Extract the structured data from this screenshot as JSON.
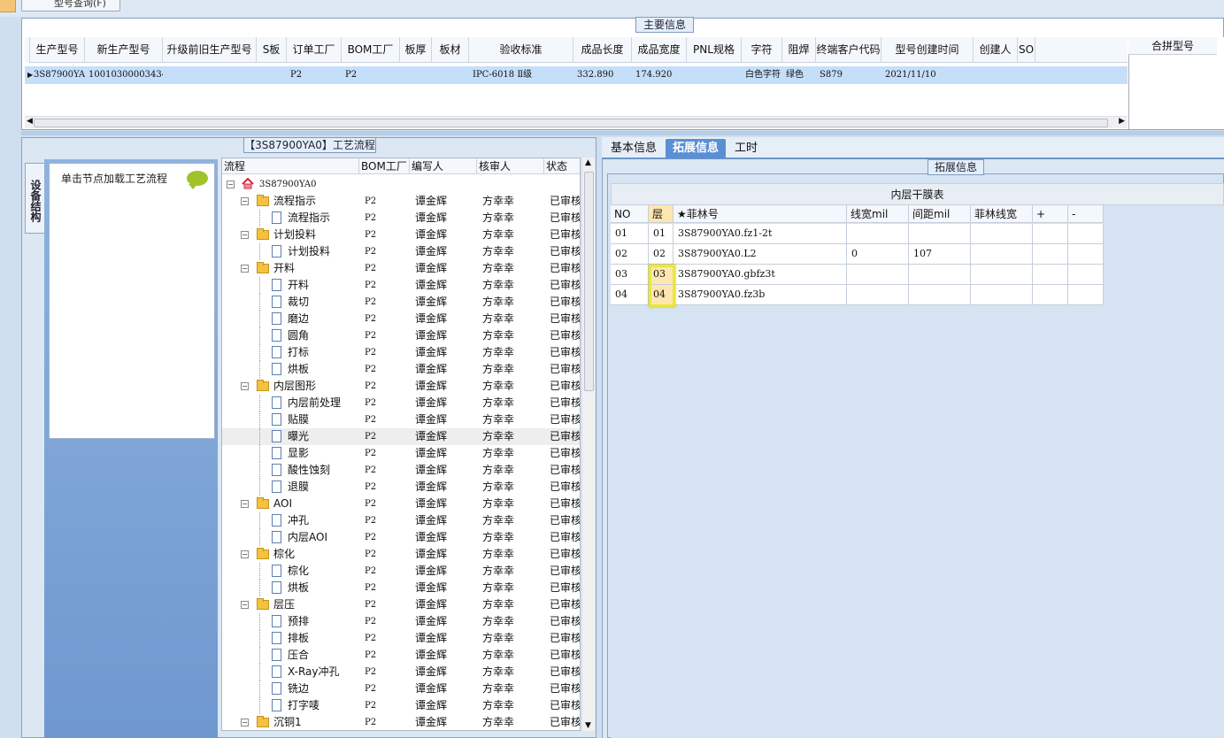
{
  "toolbar": {
    "query_button": "型号查询(F)"
  },
  "main_info": {
    "title": "主要信息",
    "columns": [
      "生产型号",
      "新生产型号",
      "升级前旧生产型号",
      "S板",
      "订单工厂",
      "BOM工厂",
      "板厚",
      "板材",
      "验收标准",
      "成品长度",
      "成品宽度",
      "PNL规格",
      "字符",
      "阻焊",
      "终端客户代码",
      "型号创建时间",
      "创建人",
      "SO"
    ],
    "row": [
      "3S87900YA0",
      "10010300003434",
      "",
      "",
      "P2",
      "P2",
      "",
      "",
      "IPC-6018 Ⅱ级",
      "332.890",
      "174.920",
      "",
      "白色字符",
      "绿色",
      "S879",
      "2021/11/10",
      "",
      ""
    ],
    "merge_header": "合拼型号"
  },
  "left": {
    "process_title": "【3S87900YA0】工艺流程",
    "side_tab": "设备结构",
    "node_hint": "单击节点加载工艺流程",
    "tree_headers": [
      "流程",
      "BOM工厂",
      "编写人",
      "核审人",
      "状态"
    ],
    "tree": [
      {
        "level": 0,
        "type": "root",
        "name": "3S87900YA0",
        "factory": "",
        "writer": "",
        "reviewer": "",
        "status": ""
      },
      {
        "level": 1,
        "type": "folder",
        "name": "流程指示",
        "factory": "P2",
        "writer": "谭金辉",
        "reviewer": "方幸幸",
        "status": "已审核"
      },
      {
        "level": 2,
        "type": "doc",
        "name": "流程指示",
        "factory": "P2",
        "writer": "谭金辉",
        "reviewer": "方幸幸",
        "status": "已审核"
      },
      {
        "level": 1,
        "type": "folder",
        "name": "计划投料",
        "factory": "P2",
        "writer": "谭金辉",
        "reviewer": "方幸幸",
        "status": "已审核"
      },
      {
        "level": 2,
        "type": "doc",
        "name": "计划投料",
        "factory": "P2",
        "writer": "谭金辉",
        "reviewer": "方幸幸",
        "status": "已审核"
      },
      {
        "level": 1,
        "type": "folder",
        "name": "开料",
        "factory": "P2",
        "writer": "谭金辉",
        "reviewer": "方幸幸",
        "status": "已审核"
      },
      {
        "level": 2,
        "type": "doc",
        "name": "开料",
        "factory": "P2",
        "writer": "谭金辉",
        "reviewer": "方幸幸",
        "status": "已审核"
      },
      {
        "level": 2,
        "type": "doc",
        "name": "裁切",
        "factory": "P2",
        "writer": "谭金辉",
        "reviewer": "方幸幸",
        "status": "已审核"
      },
      {
        "level": 2,
        "type": "doc",
        "name": "磨边",
        "factory": "P2",
        "writer": "谭金辉",
        "reviewer": "方幸幸",
        "status": "已审核"
      },
      {
        "level": 2,
        "type": "doc",
        "name": "圆角",
        "factory": "P2",
        "writer": "谭金辉",
        "reviewer": "方幸幸",
        "status": "已审核"
      },
      {
        "level": 2,
        "type": "doc",
        "name": "打标",
        "factory": "P2",
        "writer": "谭金辉",
        "reviewer": "方幸幸",
        "status": "已审核"
      },
      {
        "level": 2,
        "type": "doc",
        "name": "烘板",
        "factory": "P2",
        "writer": "谭金辉",
        "reviewer": "方幸幸",
        "status": "已审核"
      },
      {
        "level": 1,
        "type": "folder",
        "name": "内层图形",
        "factory": "P2",
        "writer": "谭金辉",
        "reviewer": "方幸幸",
        "status": "已审核"
      },
      {
        "level": 2,
        "type": "doc",
        "name": "内层前处理",
        "factory": "P2",
        "writer": "谭金辉",
        "reviewer": "方幸幸",
        "status": "已审核"
      },
      {
        "level": 2,
        "type": "doc",
        "name": "贴膜",
        "factory": "P2",
        "writer": "谭金辉",
        "reviewer": "方幸幸",
        "status": "已审核"
      },
      {
        "level": 2,
        "type": "doc",
        "name": "曝光",
        "factory": "P2",
        "writer": "谭金辉",
        "reviewer": "方幸幸",
        "status": "已审核",
        "selected": true
      },
      {
        "level": 2,
        "type": "doc",
        "name": "显影",
        "factory": "P2",
        "writer": "谭金辉",
        "reviewer": "方幸幸",
        "status": "已审核"
      },
      {
        "level": 2,
        "type": "doc",
        "name": "酸性蚀刻",
        "factory": "P2",
        "writer": "谭金辉",
        "reviewer": "方幸幸",
        "status": "已审核"
      },
      {
        "level": 2,
        "type": "doc",
        "name": "退膜",
        "factory": "P2",
        "writer": "谭金辉",
        "reviewer": "方幸幸",
        "status": "已审核"
      },
      {
        "level": 1,
        "type": "folder",
        "name": "AOI",
        "factory": "P2",
        "writer": "谭金辉",
        "reviewer": "方幸幸",
        "status": "已审核"
      },
      {
        "level": 2,
        "type": "doc",
        "name": "冲孔",
        "factory": "P2",
        "writer": "谭金辉",
        "reviewer": "方幸幸",
        "status": "已审核"
      },
      {
        "level": 2,
        "type": "doc",
        "name": "内层AOI",
        "factory": "P2",
        "writer": "谭金辉",
        "reviewer": "方幸幸",
        "status": "已审核"
      },
      {
        "level": 1,
        "type": "folder",
        "name": "棕化",
        "factory": "P2",
        "writer": "谭金辉",
        "reviewer": "方幸幸",
        "status": "已审核"
      },
      {
        "level": 2,
        "type": "doc",
        "name": "棕化",
        "factory": "P2",
        "writer": "谭金辉",
        "reviewer": "方幸幸",
        "status": "已审核"
      },
      {
        "level": 2,
        "type": "doc",
        "name": "烘板",
        "factory": "P2",
        "writer": "谭金辉",
        "reviewer": "方幸幸",
        "status": "已审核"
      },
      {
        "level": 1,
        "type": "folder",
        "name": "层压",
        "factory": "P2",
        "writer": "谭金辉",
        "reviewer": "方幸幸",
        "status": "已审核"
      },
      {
        "level": 2,
        "type": "doc",
        "name": "预排",
        "factory": "P2",
        "writer": "谭金辉",
        "reviewer": "方幸幸",
        "status": "已审核"
      },
      {
        "level": 2,
        "type": "doc",
        "name": "排板",
        "factory": "P2",
        "writer": "谭金辉",
        "reviewer": "方幸幸",
        "status": "已审核"
      },
      {
        "level": 2,
        "type": "doc",
        "name": "压合",
        "factory": "P2",
        "writer": "谭金辉",
        "reviewer": "方幸幸",
        "status": "已审核"
      },
      {
        "level": 2,
        "type": "doc",
        "name": "X-Ray冲孔",
        "factory": "P2",
        "writer": "谭金辉",
        "reviewer": "方幸幸",
        "status": "已审核"
      },
      {
        "level": 2,
        "type": "doc",
        "name": "铣边",
        "factory": "P2",
        "writer": "谭金辉",
        "reviewer": "方幸幸",
        "status": "已审核"
      },
      {
        "level": 2,
        "type": "doc",
        "name": "打字唛",
        "factory": "P2",
        "writer": "谭金辉",
        "reviewer": "方幸幸",
        "status": "已审核"
      },
      {
        "level": 1,
        "type": "folder",
        "name": "沉铜1",
        "factory": "P2",
        "writer": "谭金辉",
        "reviewer": "方幸幸",
        "status": "已审核"
      }
    ]
  },
  "right": {
    "tabs": [
      "基本信息",
      "拓展信息",
      "工时"
    ],
    "active_tab": "拓展信息",
    "section_title": "拓展信息",
    "table_title": "内层干膜表",
    "headers": [
      "NO",
      "层",
      "★菲林号",
      "线宽mil",
      "间距mil",
      "菲林线宽",
      "+",
      "-"
    ],
    "rows": [
      [
        "01",
        "01",
        "3S87900YA0.fz1-2t",
        "",
        "",
        "",
        "",
        ""
      ],
      [
        "02",
        "02",
        "3S87900YA0.L2",
        "0",
        "107",
        "",
        "",
        ""
      ],
      [
        "03",
        "03",
        "3S87900YA0.gbfz3t",
        "",
        "",
        "",
        "",
        ""
      ],
      [
        "04",
        "04",
        "3S87900YA0.fz3b",
        "",
        "",
        "",
        "",
        ""
      ]
    ]
  },
  "colors": {
    "row_selected": "#c5defa",
    "active_tab": "#5b8fd3",
    "highlight": "#e8e83a",
    "panel_blue": "#6f98cf"
  }
}
